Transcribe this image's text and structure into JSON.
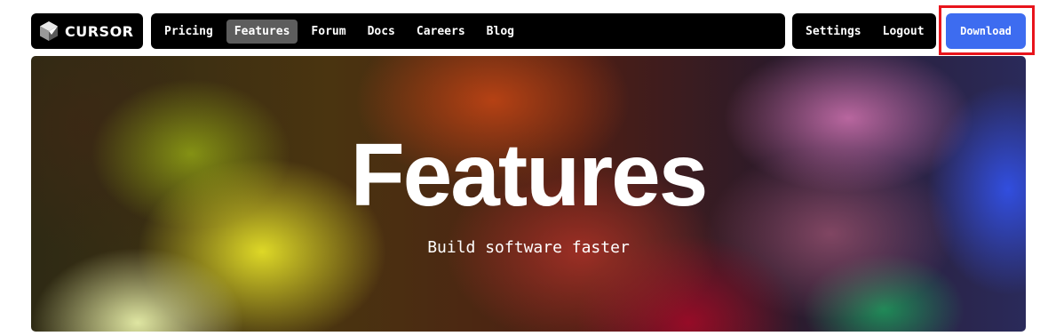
{
  "logo": {
    "text": "CURSOR",
    "icon": "cursor-cube-logo"
  },
  "nav": {
    "items": [
      {
        "label": "Pricing",
        "active": false
      },
      {
        "label": "Features",
        "active": true
      },
      {
        "label": "Forum",
        "active": false
      },
      {
        "label": "Docs",
        "active": false
      },
      {
        "label": "Careers",
        "active": false
      },
      {
        "label": "Blog",
        "active": false
      }
    ],
    "right": [
      {
        "label": "Settings"
      },
      {
        "label": "Logout"
      }
    ]
  },
  "download": {
    "label": "Download",
    "color": "#3d6cf0",
    "highlight_color": "#e8141c"
  },
  "hero": {
    "title": "Features",
    "subtitle": "Build software faster"
  }
}
